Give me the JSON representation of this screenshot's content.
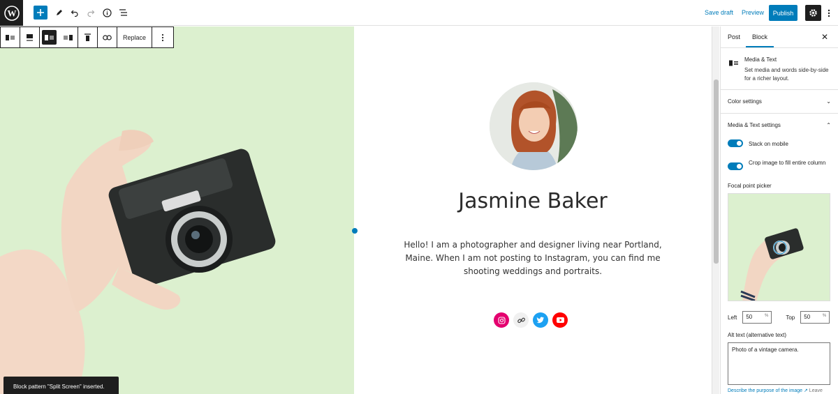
{
  "topbar": {
    "save_draft": "Save draft",
    "preview": "Preview",
    "publish": "Publish"
  },
  "block_toolbar": {
    "replace": "Replace"
  },
  "content": {
    "name": "Jasmine Baker",
    "bio": "Hello! I am a photographer and designer living near Portland, Maine. When I am not posting to Instagram, you can find me shooting weddings and portraits.",
    "social": [
      {
        "icon": "instagram-icon",
        "color": "#e4006f"
      },
      {
        "icon": "link-icon",
        "color": "#f0f0f0"
      },
      {
        "icon": "twitter-icon",
        "color": "#1da1f2"
      },
      {
        "icon": "youtube-icon",
        "color": "#ff0000"
      }
    ]
  },
  "snackbar": "Block pattern \"Split Screen\" inserted.",
  "sidebar": {
    "tabs": [
      "Post",
      "Block"
    ],
    "active_tab": "Block",
    "block_name": "Media & Text",
    "block_desc": "Set media and words side-by-side for a richer layout.",
    "color_settings": "Color settings",
    "media_text_settings": "Media & Text settings",
    "stack_on_mobile": "Stack on mobile",
    "crop_image": "Crop image to fill entire column",
    "focal_point_picker": "Focal point picker",
    "left_label": "Left",
    "left_value": "50",
    "top_label": "Top",
    "top_value": "50",
    "percent": "%",
    "alt_label": "Alt text (alternative text)",
    "alt_value": "Photo of a vintage camera.",
    "describe_link": "Describe the purpose of the image",
    "leave": "Leave"
  },
  "colors": {
    "accent": "#007cba",
    "media_bg": "#dcf0cf"
  }
}
